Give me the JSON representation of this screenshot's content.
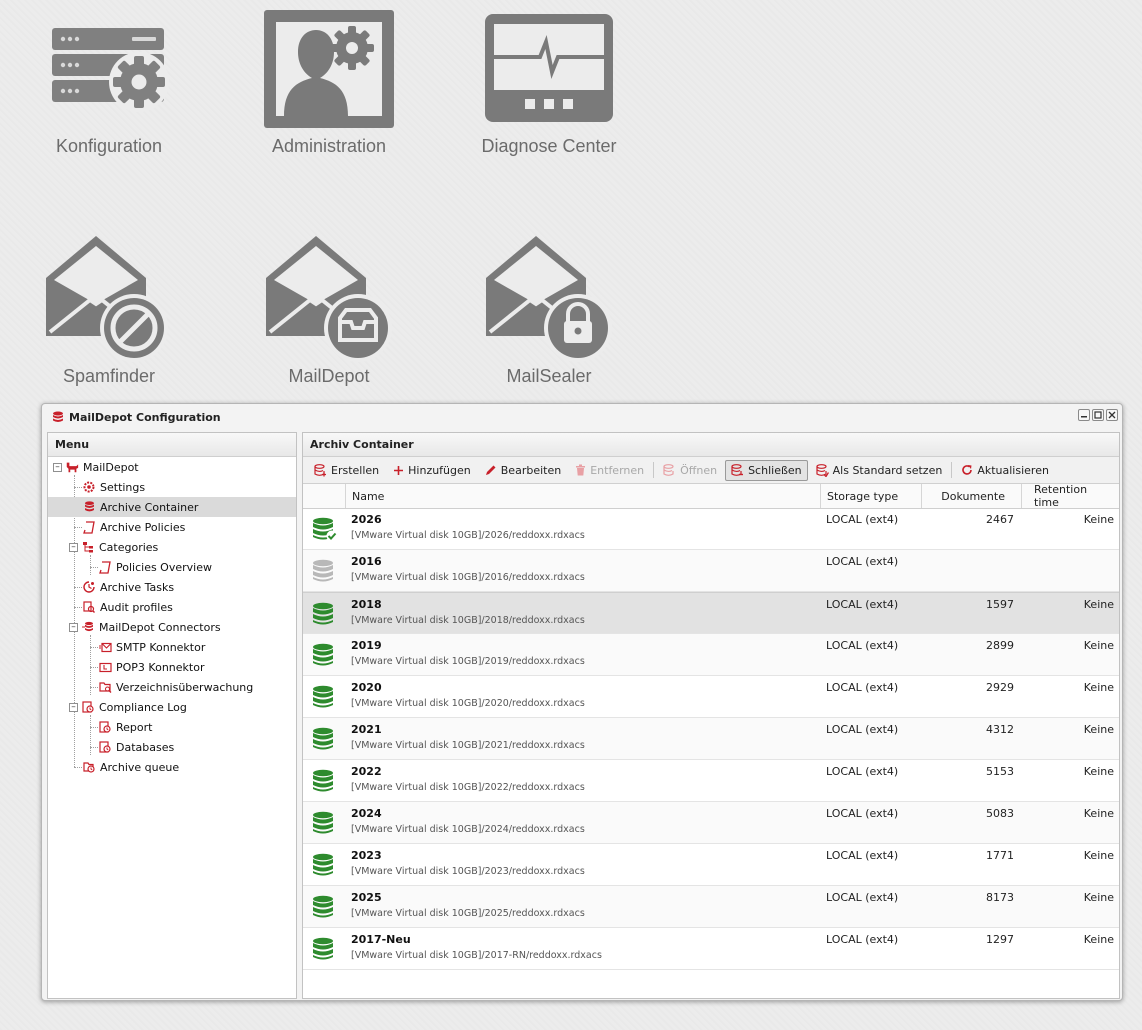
{
  "desktop": {
    "apps": [
      {
        "label": "Konfiguration",
        "icon": "server-gear-icon"
      },
      {
        "label": "Administration",
        "icon": "user-gear-icon"
      },
      {
        "label": "Diagnose Center",
        "icon": "monitor-pulse-icon"
      },
      {
        "label": "Spamfinder",
        "icon": "mail-blocked-icon"
      },
      {
        "label": "MailDepot",
        "icon": "mail-inbox-icon"
      },
      {
        "label": "MailSealer",
        "icon": "mail-lock-icon"
      }
    ]
  },
  "window": {
    "title": "MailDepot Configuration",
    "controls": [
      "minimize",
      "maximize",
      "close"
    ]
  },
  "menu": {
    "header": "Menu",
    "root": "MailDepot",
    "items": [
      {
        "label": "Settings",
        "icon": "settings-icon"
      },
      {
        "label": "Archive Container",
        "icon": "database-icon",
        "selected": true
      },
      {
        "label": "Archive Policies",
        "icon": "policy-icon"
      },
      {
        "label": "Categories",
        "icon": "categories-icon",
        "expanded": true
      },
      {
        "label": "Policies Overview",
        "icon": "policy-icon"
      },
      {
        "label": "Archive Tasks",
        "icon": "tasks-icon"
      },
      {
        "label": "Audit profiles",
        "icon": "audit-icon"
      },
      {
        "label": "MailDepot Connectors",
        "icon": "connectors-icon",
        "expanded": true
      },
      {
        "label": "SMTP Konnektor",
        "icon": "smtp-icon"
      },
      {
        "label": "POP3 Konnektor",
        "icon": "pop3-icon"
      },
      {
        "label": "Verzeichnisüberwachung",
        "icon": "folder-watch-icon"
      },
      {
        "label": "Compliance Log",
        "icon": "log-icon",
        "expanded": true
      },
      {
        "label": "Report",
        "icon": "report-icon"
      },
      {
        "label": "Databases",
        "icon": "databases-icon"
      },
      {
        "label": "Archive queue",
        "icon": "queue-icon"
      }
    ]
  },
  "content": {
    "header": "Archiv Container",
    "toolbar": {
      "erstellen": "Erstellen",
      "hinzufuegen": "Hinzufügen",
      "bearbeiten": "Bearbeiten",
      "entfernen": "Entfernen",
      "oeffnen": "Öffnen",
      "schliessen": "Schließen",
      "standard": "Als Standard setzen",
      "aktualisieren": "Aktualisieren"
    },
    "columns": {
      "name": "Name",
      "storage": "Storage type",
      "docs": "Dokumente",
      "retention": "Retention time"
    },
    "rows": [
      {
        "name": "2026",
        "path": "[VMware Virtual disk 10GB]/2026/reddoxx.rdxacs",
        "storage": "LOCAL (ext4)",
        "docs": "2467",
        "retention": "Keine",
        "state": "default"
      },
      {
        "name": "2016",
        "path": "[VMware Virtual disk 10GB]/2016/reddoxx.rdxacs",
        "storage": "LOCAL (ext4)",
        "docs": "",
        "retention": "",
        "state": "closed"
      },
      {
        "name": "2018",
        "path": "[VMware Virtual disk 10GB]/2018/reddoxx.rdxacs",
        "storage": "LOCAL (ext4)",
        "docs": "1597",
        "retention": "Keine",
        "state": "open"
      },
      {
        "name": "2019",
        "path": "[VMware Virtual disk 10GB]/2019/reddoxx.rdxacs",
        "storage": "LOCAL (ext4)",
        "docs": "2899",
        "retention": "Keine",
        "state": "open"
      },
      {
        "name": "2020",
        "path": "[VMware Virtual disk 10GB]/2020/reddoxx.rdxacs",
        "storage": "LOCAL (ext4)",
        "docs": "2929",
        "retention": "Keine",
        "state": "open"
      },
      {
        "name": "2021",
        "path": "[VMware Virtual disk 10GB]/2021/reddoxx.rdxacs",
        "storage": "LOCAL (ext4)",
        "docs": "4312",
        "retention": "Keine",
        "state": "open"
      },
      {
        "name": "2022",
        "path": "[VMware Virtual disk 10GB]/2022/reddoxx.rdxacs",
        "storage": "LOCAL (ext4)",
        "docs": "5153",
        "retention": "Keine",
        "state": "open"
      },
      {
        "name": "2024",
        "path": "[VMware Virtual disk 10GB]/2024/reddoxx.rdxacs",
        "storage": "LOCAL (ext4)",
        "docs": "5083",
        "retention": "Keine",
        "state": "open"
      },
      {
        "name": "2023",
        "path": "[VMware Virtual disk 10GB]/2023/reddoxx.rdxacs",
        "storage": "LOCAL (ext4)",
        "docs": "1771",
        "retention": "Keine",
        "state": "open"
      },
      {
        "name": "2025",
        "path": "[VMware Virtual disk 10GB]/2025/reddoxx.rdxacs",
        "storage": "LOCAL (ext4)",
        "docs": "8173",
        "retention": "Keine",
        "state": "open"
      },
      {
        "name": "2017-Neu",
        "path": "[VMware Virtual disk 10GB]/2017-RN/reddoxx.rdxacs",
        "storage": "LOCAL (ext4)",
        "docs": "1297",
        "retention": "Keine",
        "state": "open"
      }
    ]
  },
  "colors": {
    "accent_red": "#c8202a",
    "db_green": "#2e8b2e",
    "db_grey": "#b8b8b8",
    "icon_grey": "#808080"
  }
}
